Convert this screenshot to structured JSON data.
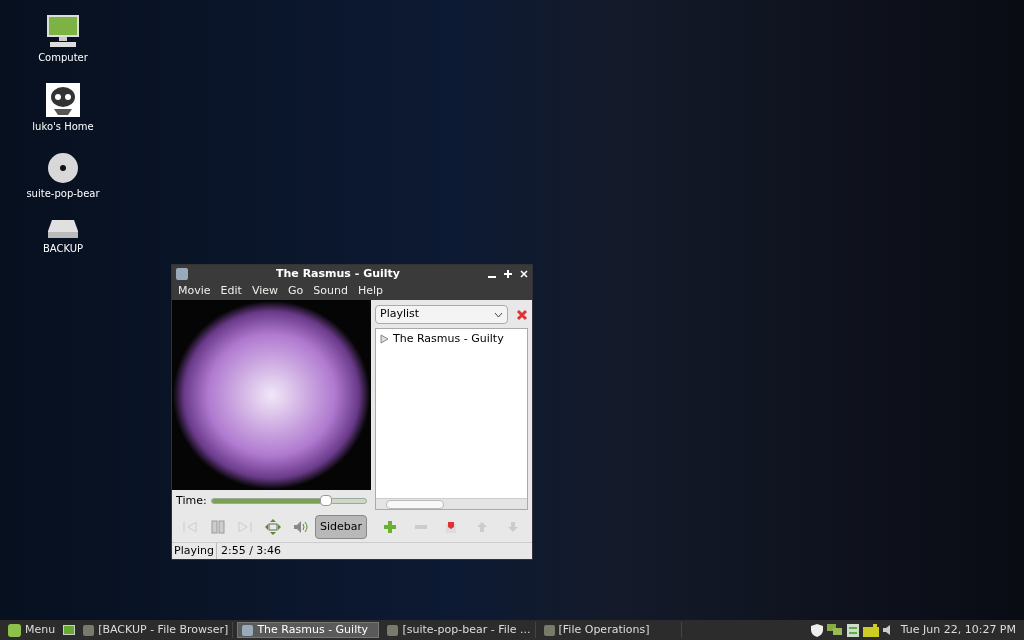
{
  "desktop_icons": [
    {
      "kind": "computer",
      "label": "Computer"
    },
    {
      "kind": "home",
      "label": "luko's Home"
    },
    {
      "kind": "disc",
      "label": "suite-pop-bear"
    },
    {
      "kind": "drive",
      "label": "BACKUP"
    }
  ],
  "window": {
    "title": "The Rasmus - Guilty",
    "menu": [
      "Movie",
      "Edit",
      "View",
      "Go",
      "Sound",
      "Help"
    ],
    "time_label": "Time:",
    "time_slider": {
      "level": 0.74
    },
    "sidebar_button": {
      "label": "Sidebar",
      "pressed": true
    },
    "playlist": {
      "selector": "Playlist",
      "items": [
        {
          "title": "The Rasmus - Guilty"
        }
      ]
    },
    "status": {
      "state": "Playing",
      "time": "2:55 / 3:46"
    }
  },
  "taskbar": {
    "menu_label": "Menu",
    "tasks": [
      {
        "label": "[BACKUP - File Browser]",
        "selected": false
      },
      {
        "label": "The Rasmus - Guilty",
        "selected": true
      },
      {
        "label": "[suite-pop-bear - File ...",
        "selected": false
      },
      {
        "label": "[File Operations]",
        "selected": false
      }
    ],
    "clock": "Tue Jun 22, 10:27 PM"
  }
}
